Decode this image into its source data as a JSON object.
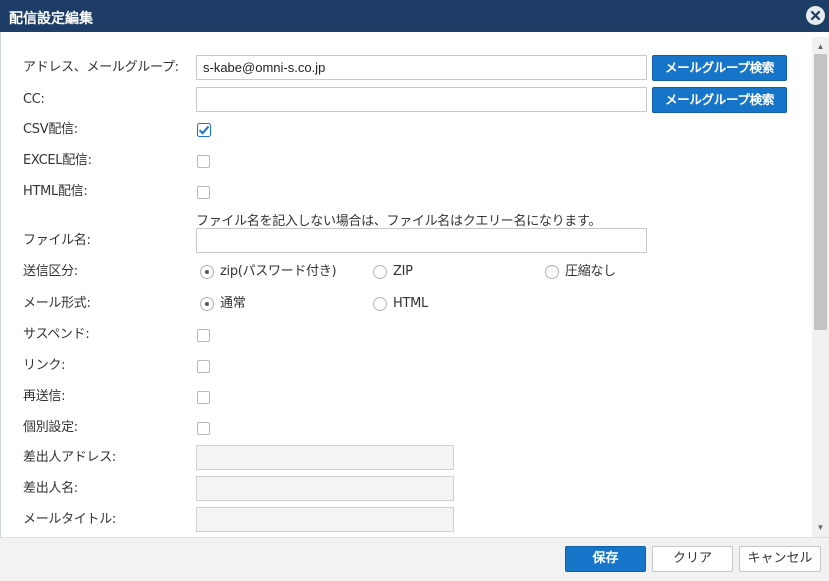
{
  "dialog": {
    "title": "配信設定編集",
    "close_icon": "close-icon"
  },
  "form": {
    "address": {
      "label": "アドレス、メールグループ:",
      "value": "s-kabe@omni-s.co.jp",
      "button": "メールグループ検索"
    },
    "cc": {
      "label": "CC:",
      "value": "",
      "button": "メールグループ検索"
    },
    "csv": {
      "label": "CSV配信:",
      "checked": true
    },
    "excel": {
      "label": "EXCEL配信:",
      "checked": false
    },
    "html": {
      "label": "HTML配信:",
      "checked": false
    },
    "filename": {
      "note": "ファイル名を記入しない場合は、ファイル名はクエリー名になります。",
      "label": "ファイル名:",
      "value": ""
    },
    "send_type": {
      "label": "送信区分:",
      "options": [
        "zip(パスワード付き)",
        "ZIP",
        "圧縮なし"
      ],
      "selected": "zip(パスワード付き)"
    },
    "mail_format": {
      "label": "メール形式:",
      "options": [
        "通常",
        "HTML"
      ],
      "selected": "通常"
    },
    "suspend": {
      "label": "サスペンド:",
      "checked": false
    },
    "link": {
      "label": "リンク:",
      "checked": false
    },
    "resend": {
      "label": "再送信:",
      "checked": false
    },
    "individual": {
      "label": "個別設定:",
      "checked": false
    },
    "sender_address": {
      "label": "差出人アドレス:",
      "value": ""
    },
    "sender_name": {
      "label": "差出人名:",
      "value": ""
    },
    "mail_title": {
      "label": "メールタイトル:",
      "value": ""
    }
  },
  "footer": {
    "save": "保存",
    "clear": "クリア",
    "cancel": "キャンセル"
  },
  "colors": {
    "titlebar": "#1d3c66",
    "primary_button": "#1775c9",
    "checkbox_check": "#1775c9"
  }
}
